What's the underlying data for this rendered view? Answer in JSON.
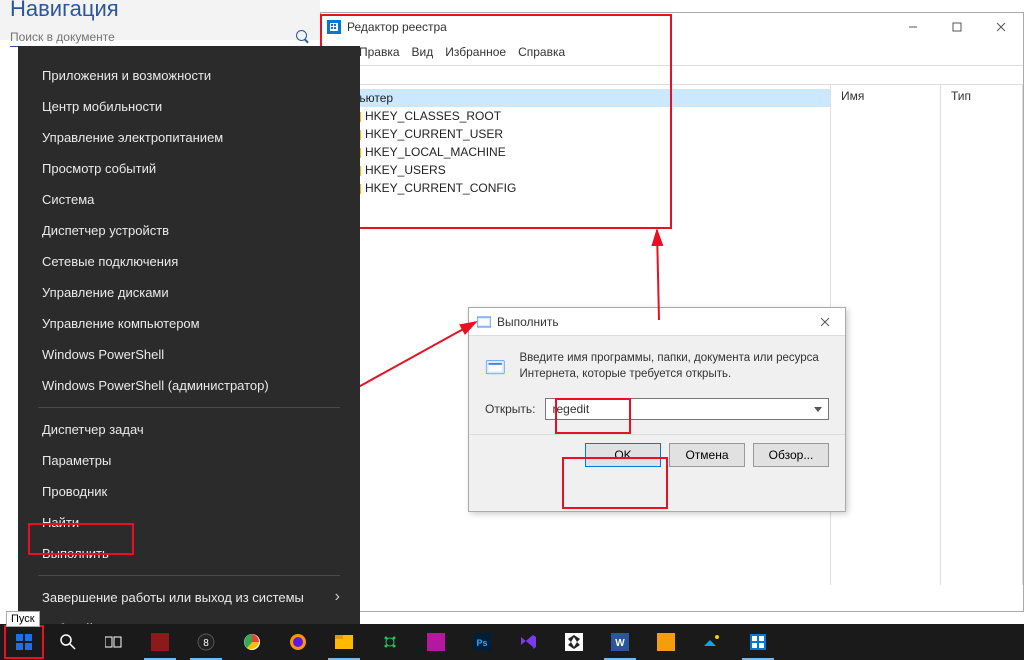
{
  "word_panel": {
    "title": "Навигация",
    "search_placeholder": "Поиск в документе"
  },
  "regedit": {
    "title": "Редактор реестра",
    "menu": [
      "Правка",
      "Вид",
      "Избранное",
      "Справка"
    ],
    "addr": "ютер",
    "root": "Компьютер",
    "hives": [
      "HKEY_CLASSES_ROOT",
      "HKEY_CURRENT_USER",
      "HKEY_LOCAL_MACHINE",
      "HKEY_USERS",
      "HKEY_CURRENT_CONFIG"
    ],
    "cols": {
      "name": "Имя",
      "type": "Тип"
    }
  },
  "run": {
    "title": "Выполнить",
    "prompt": "Введите имя программы, папки, документа или ресурса Интернета, которые требуется открыть.",
    "open_label": "Открыть:",
    "value": "regedit",
    "ok": "OK",
    "cancel": "Отмена",
    "browse": "Обзор..."
  },
  "ctx": {
    "items_top": [
      "Приложения и возможности",
      "Центр мобильности",
      "Управление электропитанием",
      "Просмотр событий",
      "Система",
      "Диспетчер устройств",
      "Сетевые подключения",
      "Управление дисками",
      "Управление компьютером",
      "Windows PowerShell",
      "Windows PowerShell (администратор)"
    ],
    "items_mid": [
      "Диспетчер задач",
      "Параметры",
      "Проводник",
      "Найти",
      "Выполнить"
    ],
    "items_bot": [
      "Завершение работы или выход из системы",
      "Рабочий стол"
    ]
  },
  "start_tooltip": "Пуск"
}
